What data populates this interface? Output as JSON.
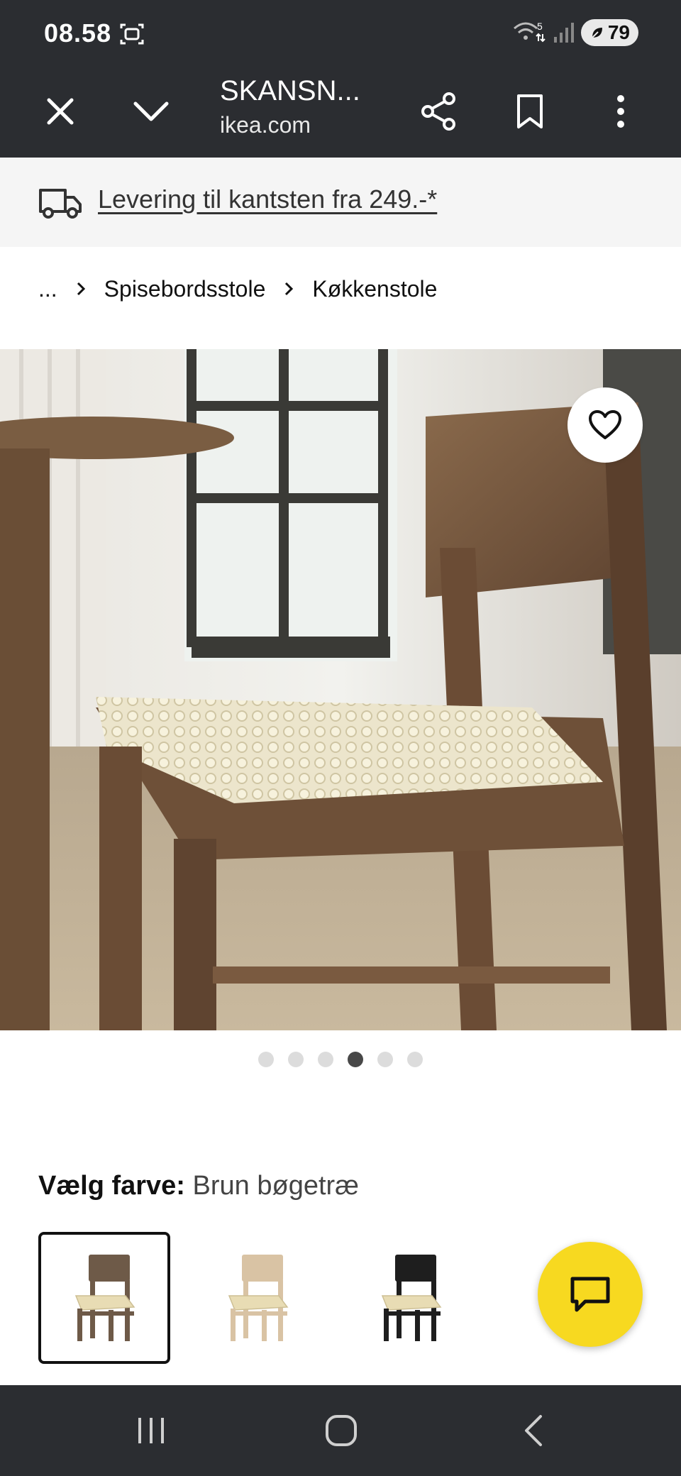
{
  "status_bar": {
    "time": "08.58",
    "battery": "79",
    "icons": [
      "screen-record-icon",
      "wifi-icon",
      "signal-icon",
      "battery-icon"
    ]
  },
  "toolbar": {
    "title": "SKANSN...",
    "url": "ikea.com",
    "icons": [
      "close-icon",
      "chevron-down-icon",
      "share-icon",
      "bookmark-icon",
      "more-icon"
    ]
  },
  "delivery": {
    "text": "Levering til kantsten fra 249.-*"
  },
  "breadcrumb": {
    "ellipsis": "...",
    "items": [
      "Spisebordsstole",
      "Køkkenstole"
    ]
  },
  "product_image": {
    "total_images": 6,
    "active_index": 3
  },
  "color_chooser": {
    "label": "Vælg farve:",
    "value": "Brun bøgetræ",
    "options": [
      {
        "name": "brown",
        "frame_color": "#6e5a48",
        "selected": true
      },
      {
        "name": "natural",
        "frame_color": "#d9c3a4",
        "selected": false
      },
      {
        "name": "black",
        "frame_color": "#1e1e1e",
        "selected": false
      }
    ]
  },
  "colors": {
    "dark_bar": "#2b2d31",
    "banner_bg": "#f5f5f5",
    "chat_fab": "#f7d920"
  }
}
